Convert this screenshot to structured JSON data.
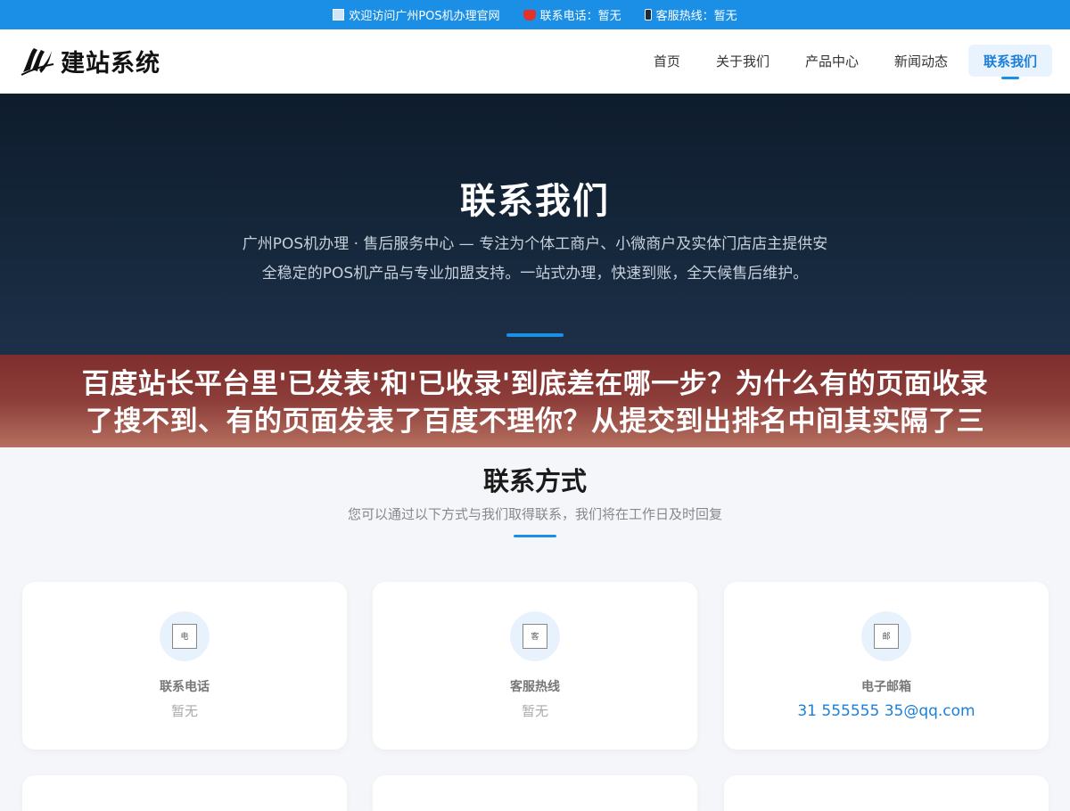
{
  "topbar": {
    "welcome": "欢迎访问广州POS机办理官网",
    "phone": "联系电话：暂无",
    "hotline": "客服热线：暂无"
  },
  "header": {
    "logo_text": "建站系统",
    "nav": [
      {
        "label": "首页",
        "active": false
      },
      {
        "label": "关于我们",
        "active": false
      },
      {
        "label": "产品中心",
        "active": false
      },
      {
        "label": "新闻动态",
        "active": false
      },
      {
        "label": "联系我们",
        "active": true
      }
    ]
  },
  "hero": {
    "title": "联系我们",
    "description": "广州POS机办理 · 售后服务中心 — 专注为个体工商户、小微商户及实体门店店主提供安全稳定的POS机产品与专业加盟支持。一站式办理，快速到账，全天候售后维护。"
  },
  "banner": {
    "line1": "百度站长平台里'已发表'和'已收录'到底差在哪一步？为什么有的页面收录",
    "line2": "了搜不到、有的页面发表了百度不理你？从提交到出排名中间其实隔了三"
  },
  "contact": {
    "title": "联系方式",
    "subtitle": "您可以通过以下方式与我们取得联系，我们将在工作日及时回复",
    "cards": [
      {
        "label": "联系电话",
        "value": "暂无",
        "icon_alt": "电"
      },
      {
        "label": "客服热线",
        "value": "暂无",
        "icon_alt": "客"
      },
      {
        "label": "电子邮箱",
        "value": "31 555555 35@qq.com",
        "icon_alt": "邮"
      }
    ]
  },
  "colors": {
    "accent": "#1b8fe6",
    "hero_bg": "#16283c",
    "banner_bg": "#8d3e3a"
  }
}
